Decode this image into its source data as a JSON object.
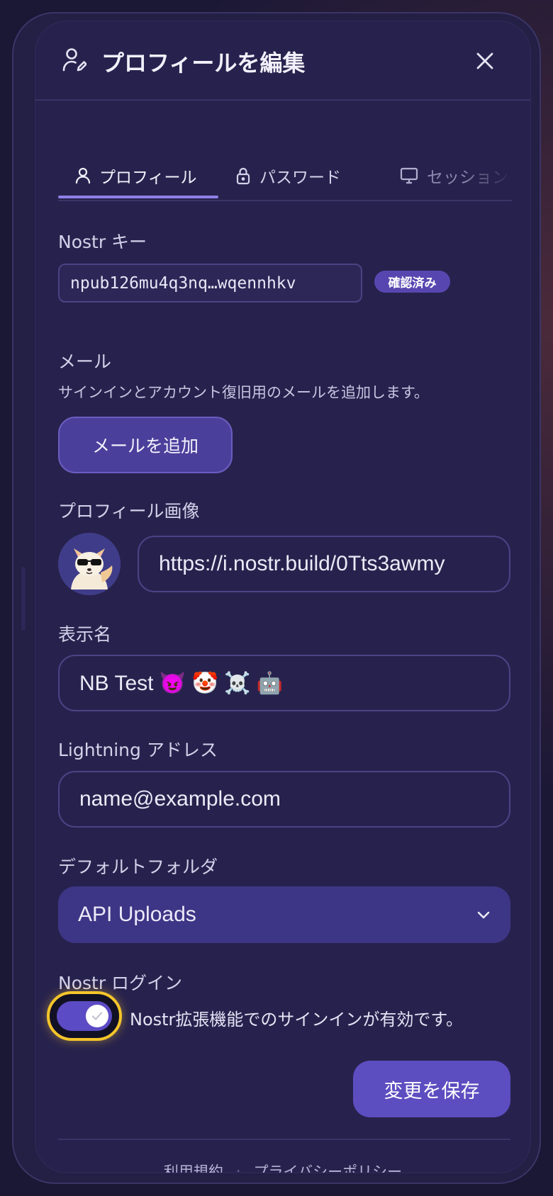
{
  "modal": {
    "title": "プロフィールを編集",
    "close_label": "×"
  },
  "tabs": [
    {
      "label": "プロフィール",
      "icon": "user-icon",
      "active": true
    },
    {
      "label": "パスワード",
      "icon": "lock-icon",
      "active": false
    },
    {
      "label": "セッション",
      "icon": "monitor-icon",
      "active": false
    }
  ],
  "nostr_key": {
    "label": "Nostr キー",
    "value": "npub126mu4q3nq…wqennhkv",
    "badge": "確認済み"
  },
  "email": {
    "label": "メール",
    "helper": "サインインとアカウント復旧用のメールを追加します。",
    "add_button": "メールを追加"
  },
  "profile_image": {
    "label": "プロフィール画像",
    "url": "https://i.nostr.build/0Tts3awmy"
  },
  "display_name": {
    "label": "表示名",
    "value": "NB Test 😈 🤡 ☠️ 🤖"
  },
  "lightning": {
    "label": "Lightning アドレス",
    "placeholder": "name@example.com"
  },
  "default_folder": {
    "label": "デフォルトフォルダ",
    "selected": "API Uploads"
  },
  "nostr_login": {
    "label": "Nostr ログイン",
    "enabled": true,
    "status_text": "Nostr拡張機能でのサインインが有効です。"
  },
  "save_button": "変更を保存",
  "footer": {
    "terms": "利用規約",
    "separator": "·",
    "privacy": "プライバシーポリシー"
  },
  "colors": {
    "accent": "#5c4dc0",
    "focus_ring": "#f4c52b",
    "background": "#27224d"
  }
}
